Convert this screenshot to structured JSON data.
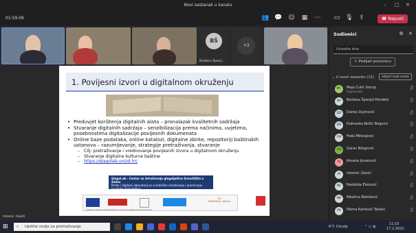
{
  "window": {
    "title": "Novi sastanak u kanalu"
  },
  "toolbar": {
    "timer": "01:59:06",
    "leave_label": "Napusti"
  },
  "tiles": [
    {
      "name": ""
    },
    {
      "name": ""
    },
    {
      "name": ""
    },
    {
      "initials": "BŠ",
      "name": "Barbara Španj..."
    },
    {
      "more": "+3"
    },
    {
      "name": ""
    }
  ],
  "slide": {
    "title": "1. Povijesni izvori u digitalnom okruženju",
    "bullets": [
      "Preduvjet korištenja digitalnih alata – pronalazak kvalitetnih sadržaja",
      "Stvaranje digitalnih sadržaja – senzibilizacija prema načinima,  uvjetima, posebnostima digitalizacije povijesnih dokumenata",
      "Online baze podataka, online katalozi, digitalne zbirke, repozitoriji baštinskih ustanova – razumijevanje, strategije pretraživanja, stvaranje"
    ],
    "subs": [
      "Cilj: pretraživanje i vrednovanje povijesnih izvora u digitalnom okruženju",
      "Stvaranje digitalne kulturne baštine"
    ],
    "link": "https://glagolab.unizd.hr/",
    "banner_title": "Glagol.ab - Centar za istraživanje glagoljaštva Sveučilišta u Zadru",
    "banner_sub": "Portal i digitalni laboratorij za suradničke istraživanja i promicanje hrvatske glagoljaštva",
    "logo_text": "ProPeTeOn-uZadru",
    "footer": "Projekt je sufinancirala Europska unija iz Europskog socijalnog fonda."
  },
  "self_label": "mtomic (Gost)",
  "panel": {
    "title": "Sudionici",
    "input_placeholder": "Unesite ime",
    "share_label": "Podijeli pozivnicu",
    "section": "U ovom sastanku (13)",
    "mute_all": "Isključi zvuk svima",
    "participants": [
      {
        "initials": "MČ",
        "name": "Maja Ćutić Gorup",
        "role": "Organizator",
        "color": "#9ccc65"
      },
      {
        "initials": "BP",
        "name": "Barbara Španjol-Pandelo",
        "role": "",
        "color": "#cfd8dc"
      },
      {
        "initials": "DD",
        "name": "Danko Dujmović",
        "role": "",
        "color": "#cfd8dc"
      },
      {
        "initials": "DB",
        "name": "Dubravka Božić Bogović",
        "role": "",
        "color": "#cfd8dc"
      },
      {
        "initials": "FM",
        "name": "Feda Milivojević",
        "role": "",
        "color": "#cfd8dc"
      },
      {
        "initials": "GB",
        "name": "Goran Bilogrivić",
        "role": "",
        "color": "#7cb342"
      },
      {
        "initials": "KJ",
        "name": "Kosana Jovanović",
        "role": "",
        "color": "#ef9a9a"
      },
      {
        "initials": "M",
        "name": "mtomic (Gost)",
        "role": "",
        "color": "#cfd8dc"
      },
      {
        "initials": "NE",
        "name": "Nadežda Elezović",
        "role": "",
        "color": "#cfd8dc"
      },
      {
        "initials": "NB",
        "name": "Nikolina Belošević",
        "role": "",
        "color": "#cfd8dc"
      },
      {
        "initials": "PK",
        "name": "Palma Karković Takalić",
        "role": "",
        "color": "#cfd8dc"
      }
    ]
  },
  "taskbar": {
    "search_placeholder": "Upišite ovdje za pretraživanje",
    "weather": "6°C  Cloudy",
    "time": "11:15",
    "date": "17.2.2022."
  }
}
